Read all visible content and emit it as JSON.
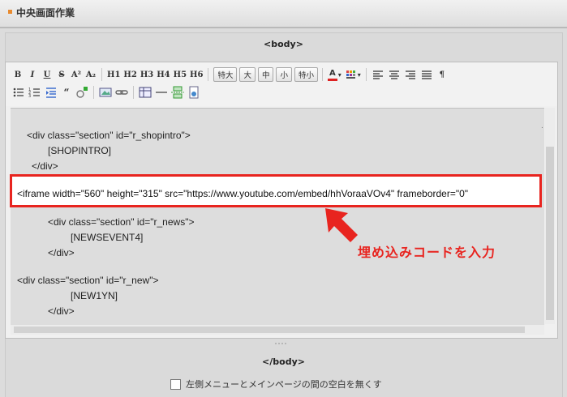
{
  "header": {
    "title": "中央画面作業"
  },
  "tags": {
    "open": "<body>",
    "close": "</body>"
  },
  "toolbar": {
    "row1_text": [
      "B",
      "I",
      "U",
      "S",
      "A²",
      "A₂",
      "H1",
      "H2",
      "H3",
      "H4",
      "H5",
      "H6"
    ],
    "font_sizes": [
      "特大",
      "大",
      "中",
      "小",
      "特小"
    ],
    "text_color_label": "A",
    "align_end": "¶"
  },
  "editor": {
    "lines": [
      "<div class=\"section\" id=\"r_shopintro\">",
      "[SHOPINTRO]",
      "</div>",
      "<div class=\"section\" id=\"r_news\">",
      "[NEWSEVENT4]",
      "</div>",
      "<div class=\"section\" id=\"r_new\">",
      "[NEW1YN]",
      "</div>"
    ],
    "iframe_code": "<iframe width=\"560\" height=\"315\" src=\"https://www.youtube.com/embed/hhVoraaVOv4\" frameborder=\"0\"",
    "dot": "."
  },
  "annotation": {
    "callout": "埋め込みコードを入力",
    "color": "#e8241f"
  },
  "footer": {
    "checkbox_label": "左側メニューとメインページの間の空白を無くす",
    "checked": false
  }
}
